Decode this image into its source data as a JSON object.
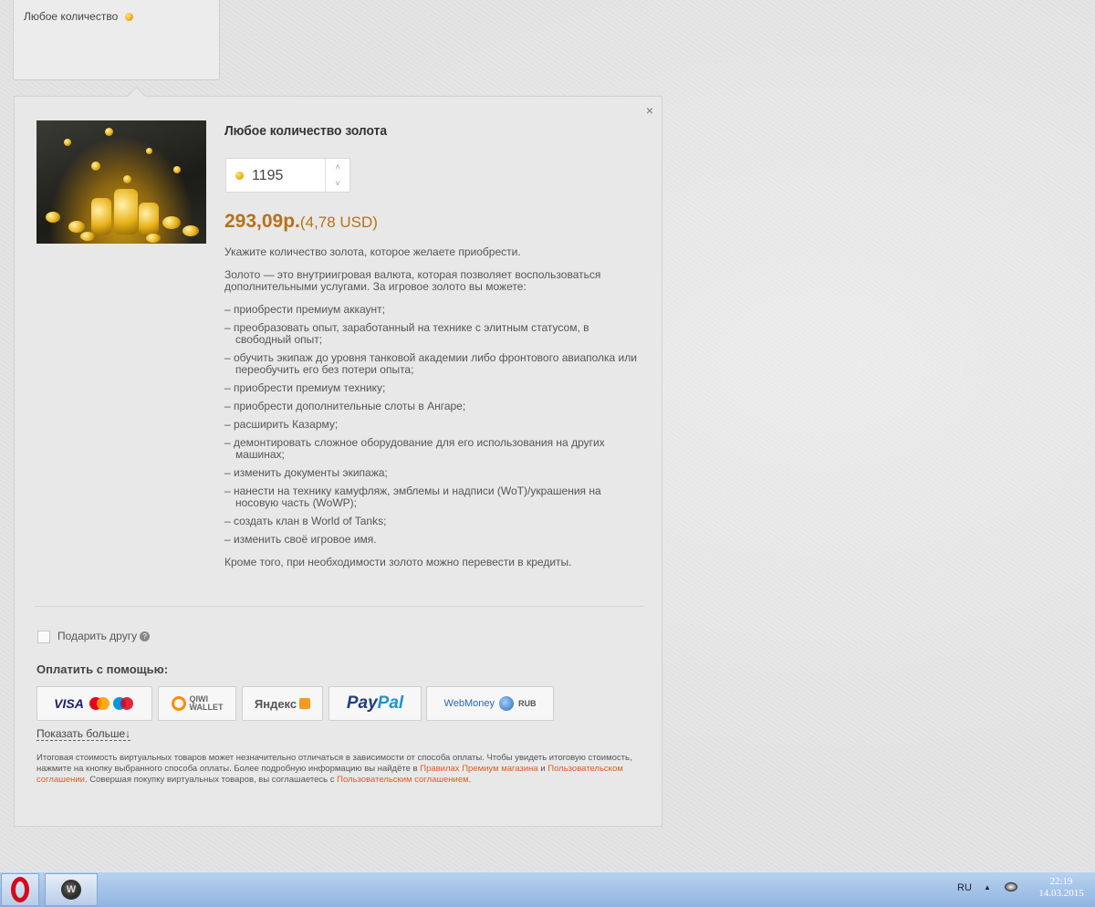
{
  "top_card": {
    "label": "Любое количество"
  },
  "product": {
    "title": "Любое количество золота",
    "quantity": "1195",
    "price": "293,09р.",
    "price_usd": "(4,78 USD)"
  },
  "panel": {
    "close": "×"
  },
  "description": {
    "intro": "Укажите количество золота, которое желаете приобрести.",
    "para": "Золото — это внутриигровая валюта, которая позволяет воспользоваться дополнительными услугами. За игровое золото вы можете:",
    "items": [
      "– приобрести премиум аккаунт;",
      "– преобразовать опыт, заработанный на технике с элитным статусом, в свободный опыт;",
      "– обучить экипаж до уровня танковой академии либо фронтового авиаполка или переобучить его без потери опыта;",
      "– приобрести премиум технику;",
      "– приобрести дополнительные слоты в Ангаре;",
      "– расширить Казарму;",
      "– демонтировать сложное оборудование для его использования на других машинах;",
      "– изменить документы экипажа;",
      "– нанести на технику камуфляж, эмблемы и надписи (WoT)/украшения на носовую часть (WoWP);",
      "– создать клан в World of Tanks;",
      "– изменить своё игровое имя."
    ],
    "outro": "Кроме того, при необходимости золото можно перевести в кредиты."
  },
  "gift": {
    "label": "Подарить другу",
    "help": "?"
  },
  "payment": {
    "title": "Оплатить с помощью:",
    "visa": "VISA",
    "qiwi_line1": "QIWI",
    "qiwi_line2": "WALLET",
    "yandex": "Яндекс",
    "paypal_1": "Pay",
    "paypal_2": "Pal",
    "webmoney": "WebMoney",
    "webmoney_rub": "RUB",
    "show_more": "Показать больше↓"
  },
  "disclaimer": {
    "text1": "Итоговая стоимость виртуальных товаров может незначительно отличаться в зависимости от способа оплаты. Чтобы увидеть итоговую стоимость, нажмите на кнопку выбранного способа оплаты. Более подробную информацию вы найдёте в ",
    "link1": "Правилах Премиум магазина",
    "text2": " и ",
    "link2": "Пользовательском соглашении",
    "text3": ". Совершая покупку виртуальных товаров, вы соглашаетесь с ",
    "link3": "Пользовательским соглашением",
    "text4": "."
  },
  "taskbar": {
    "lang": "RU",
    "tray_up": "▲",
    "time": "22:19",
    "date": "14.03.2015"
  },
  "colors": {
    "price": "#b57219",
    "link": "#e15b1f",
    "taskbar": "#a7c3e8"
  },
  "icons": [
    "coin-icon",
    "close-icon",
    "help-icon",
    "opera-icon",
    "wot-icon",
    "network-icon"
  ]
}
